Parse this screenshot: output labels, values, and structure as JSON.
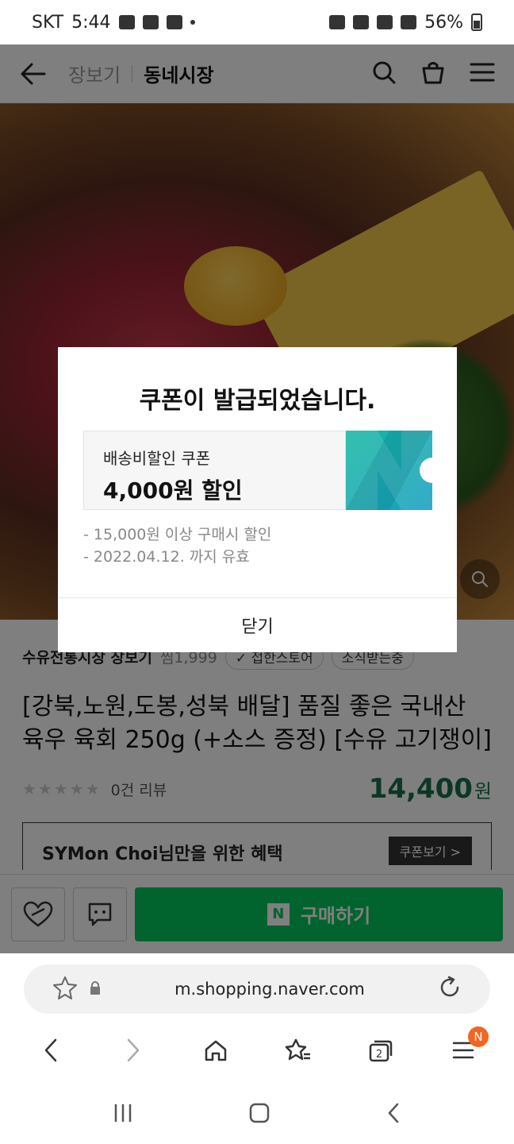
{
  "status_bar": {
    "carrier": "SKT",
    "time": "5:44",
    "battery": "56%"
  },
  "header": {
    "crumb_primary": "장보기",
    "crumb_secondary": "동네시장"
  },
  "product": {
    "seller": "수유전통시장 장보기",
    "seller_favs": "찜1,999",
    "badge_1": "✓ 접한스토어",
    "badge_2": "소식받는중",
    "title": "[강북,노원,도봉,성북 배달] 품질 좋은 국내산 육우 육회 250g (+소스 증정) [수유 고기쟁이]",
    "stars": "★★★★★",
    "review_count": "0건 리뷰",
    "price": "14,400",
    "price_unit": "원",
    "benefit_text": "SYMon Choi님만을 위한 혜택",
    "coupon_view": "쿠폰보기 >"
  },
  "action_bar": {
    "buy_label": "구매하기",
    "buy_badge": "N"
  },
  "modal": {
    "title": "쿠폰이 발급되었습니다.",
    "coupon_name": "배송비할인 쿠폰",
    "coupon_amount": "4,000원 할인",
    "condition_1": "- 15,000원 이상 구매시 할인",
    "condition_2": "- 2022.04.12. 까지 유효",
    "close_label": "닫기"
  },
  "browser": {
    "url": "m.shopping.naver.com",
    "menu_badge": "N"
  },
  "colors": {
    "accent_green": "#03c75a",
    "price_green": "#1a6e4a",
    "coupon_teal": "#16b8a3"
  }
}
